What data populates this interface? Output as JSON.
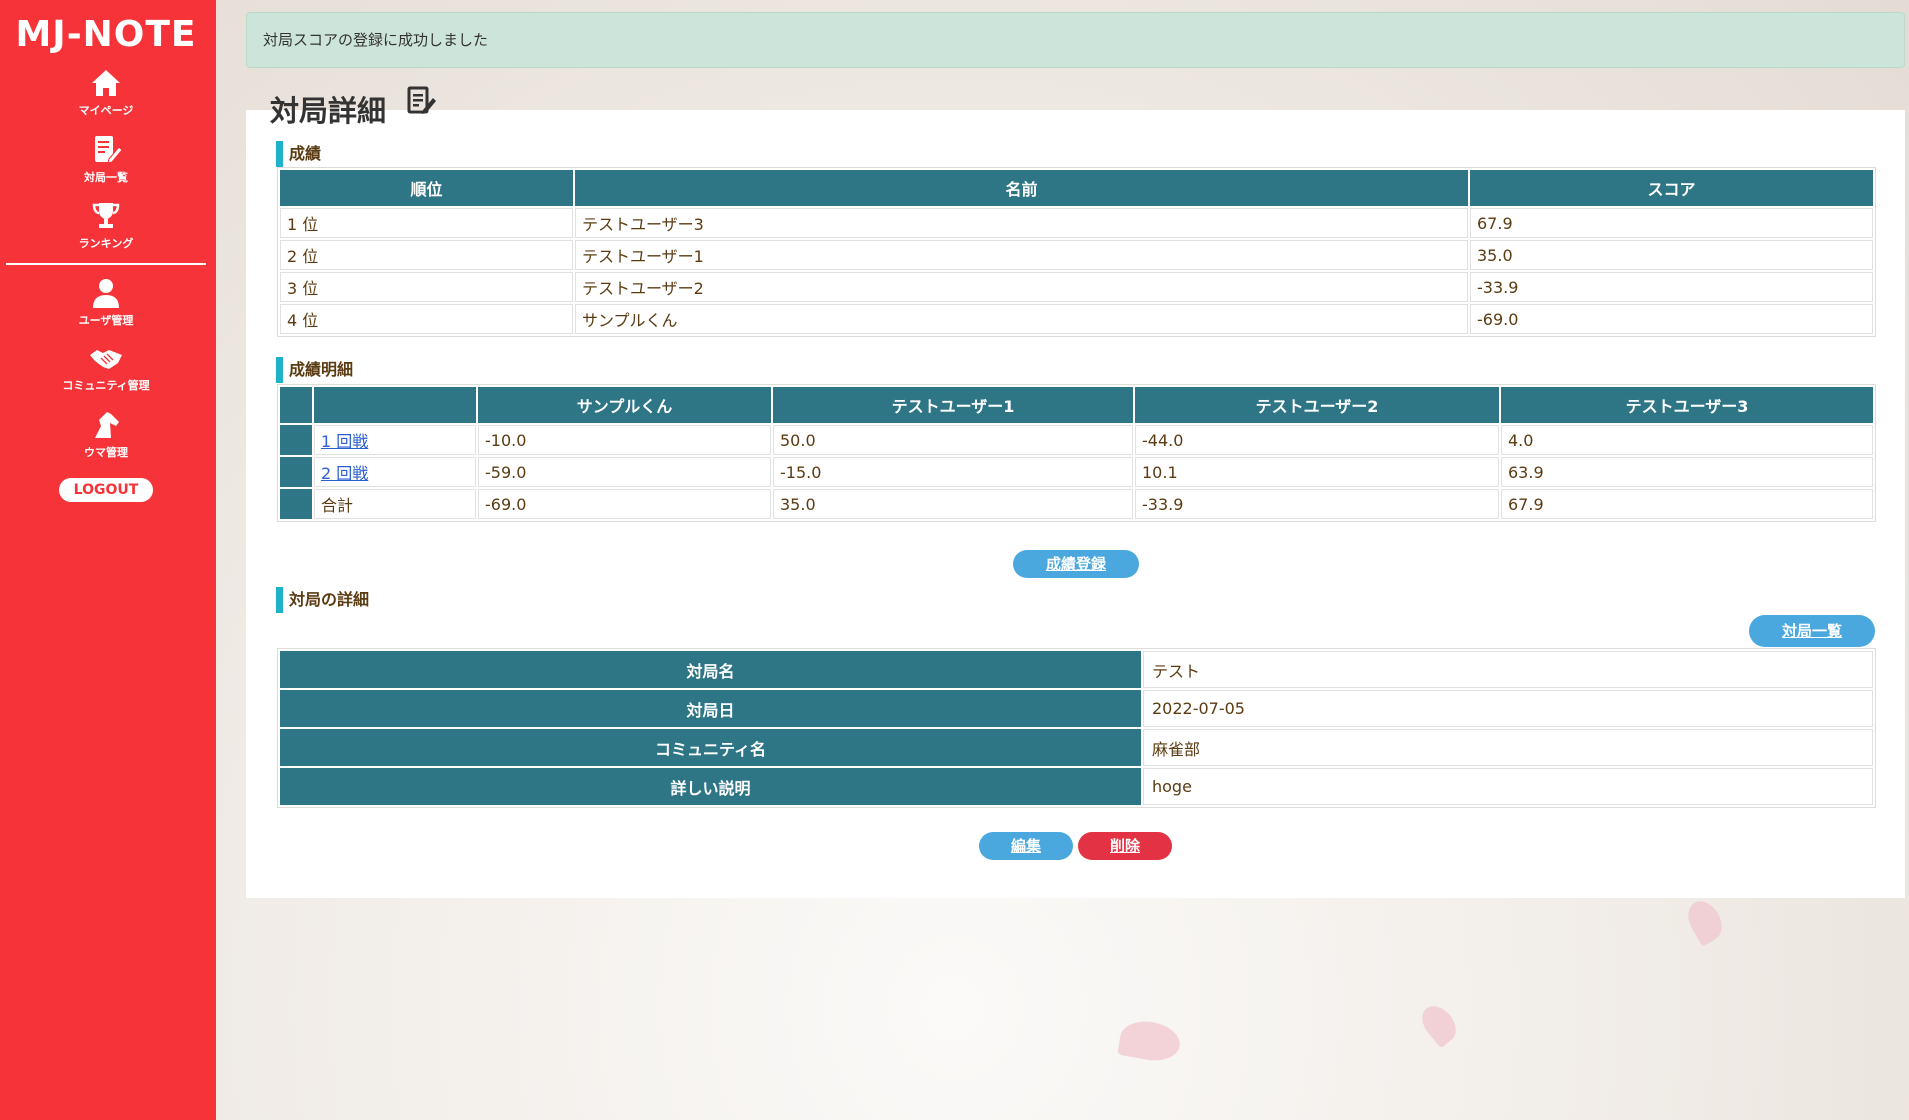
{
  "app": {
    "logo": "MJ-NOTE"
  },
  "sidebar": {
    "items": [
      {
        "label": "マイページ",
        "icon": "home-icon"
      },
      {
        "label": "対局一覧",
        "icon": "edit-note-icon"
      },
      {
        "label": "ランキング",
        "icon": "trophy-icon"
      },
      {
        "label": "ユーザ管理",
        "icon": "user-icon"
      },
      {
        "label": "コミュニティ管理",
        "icon": "handshake-icon"
      },
      {
        "label": "ウマ管理",
        "icon": "horse-icon"
      }
    ],
    "logout": "LOGOUT"
  },
  "alert": {
    "message": "対局スコアの登録に成功しました"
  },
  "page": {
    "title": "対局詳細",
    "title_icon": "edit-note-icon"
  },
  "results": {
    "heading": "成績",
    "headers": [
      "順位",
      "名前",
      "スコア"
    ],
    "rows": [
      {
        "rank": "1 位",
        "name": "テストユーザー3",
        "score": "67.9"
      },
      {
        "rank": "2 位",
        "name": "テストユーザー1",
        "score": "35.0"
      },
      {
        "rank": "3 位",
        "name": "テストユーザー2",
        "score": "-33.9"
      },
      {
        "rank": "4 位",
        "name": "サンプルくん",
        "score": "-69.0"
      }
    ]
  },
  "details": {
    "heading": "成績明細",
    "headers": [
      "サンプルくん",
      "テストユーザー1",
      "テストユーザー2",
      "テストユーザー3"
    ],
    "rows": [
      {
        "label": "1 回戦",
        "link": true,
        "values": [
          "-10.0",
          "50.0",
          "-44.0",
          "4.0"
        ]
      },
      {
        "label": "2 回戦",
        "link": true,
        "values": [
          "-59.0",
          "-15.0",
          "10.1",
          "63.9"
        ]
      },
      {
        "label": "合計",
        "link": false,
        "values": [
          "-69.0",
          "35.0",
          "-33.9",
          "67.9"
        ]
      }
    ],
    "register_button": "成績登録"
  },
  "match": {
    "heading": "対局の詳細",
    "list_button": "対局一覧",
    "fields": [
      {
        "label": "対局名",
        "value": "テスト"
      },
      {
        "label": "対局日",
        "value": "2022-07-05"
      },
      {
        "label": "コミュニティ名",
        "value": "麻雀部"
      },
      {
        "label": "詳しい説明",
        "value": "hoge"
      }
    ],
    "edit_button": "編集",
    "delete_button": "削除"
  },
  "colors": {
    "sidebar": "#f53339",
    "table_header": "#2e7586",
    "accent_bar": "#1fb3c9",
    "button_blue": "#4aa8df",
    "button_red": "#e23244",
    "alert_bg": "#cde4da"
  }
}
